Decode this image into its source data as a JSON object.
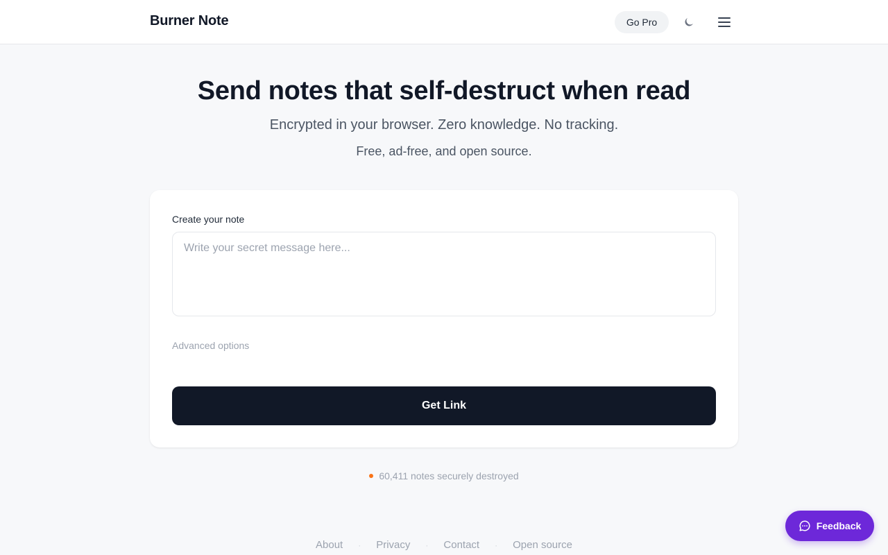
{
  "header": {
    "brand": "Burner Note",
    "go_pro_label": "Go Pro",
    "theme_icon": "moon-icon",
    "menu_icon": "hamburger-menu-icon"
  },
  "hero": {
    "title": "Send notes that self-destruct when read",
    "subtitle": "Encrypted in your browser. Zero knowledge. No tracking.",
    "tagline": "Free, ad-free, and open source."
  },
  "form": {
    "label": "Create your note",
    "placeholder": "Write your secret message here...",
    "value": "",
    "advanced_label": "Advanced options",
    "submit_label": "Get Link"
  },
  "stats": {
    "text": "60,411 notes securely destroyed",
    "dot_color": "#f97316"
  },
  "footer": {
    "links": [
      "About",
      "Privacy",
      "Contact",
      "Open source"
    ],
    "separator": "·"
  },
  "feedback": {
    "label": "Feedback",
    "icon": "chat-bubble-icon",
    "color": "#6d28d9"
  }
}
